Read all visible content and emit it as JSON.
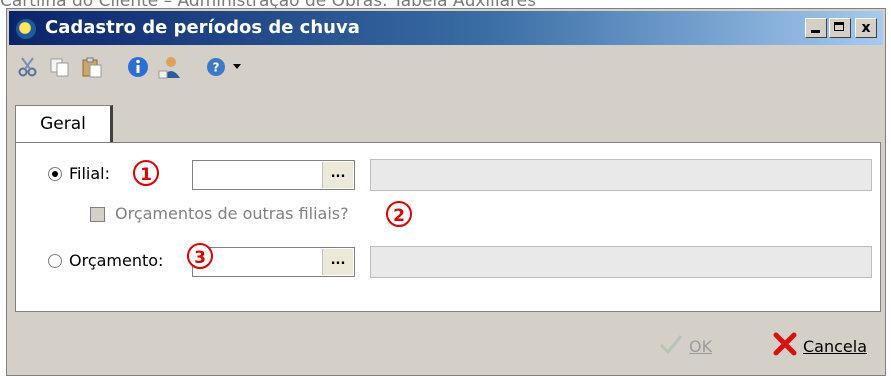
{
  "page": {
    "caption": "Cartilha do Cliente – Administração de Obras: Tabela Auxiliares"
  },
  "window": {
    "title": "Cadastro de períodos de chuva",
    "controls": {
      "close_label": "x"
    }
  },
  "toolbar": {
    "icons": [
      "scissors-icon",
      "copy-icon",
      "paste-icon",
      "info-icon",
      "user-icon",
      "help-icon",
      "chevron-down-icon"
    ]
  },
  "tabs": [
    {
      "label": "Geral",
      "selected": true
    }
  ],
  "form": {
    "filial": {
      "label": "Filial:",
      "selected": true,
      "value": "",
      "annotation": "1",
      "lookup": "..."
    },
    "outras_filiais": {
      "label": "Orçamentos de outras filiais?",
      "checked": false,
      "enabled": false,
      "annotation": "2"
    },
    "orcamento": {
      "label": "Orçamento:",
      "selected": false,
      "value": "",
      "annotation": "3",
      "lookup": "..."
    }
  },
  "footer": {
    "ok_label": "OK",
    "cancel_label": "Cancela"
  },
  "colors": {
    "title_bar": "#0a246a",
    "annotation": "#e00000",
    "cancel_icon": "#d81010",
    "ok_icon": "#9ab59a"
  }
}
